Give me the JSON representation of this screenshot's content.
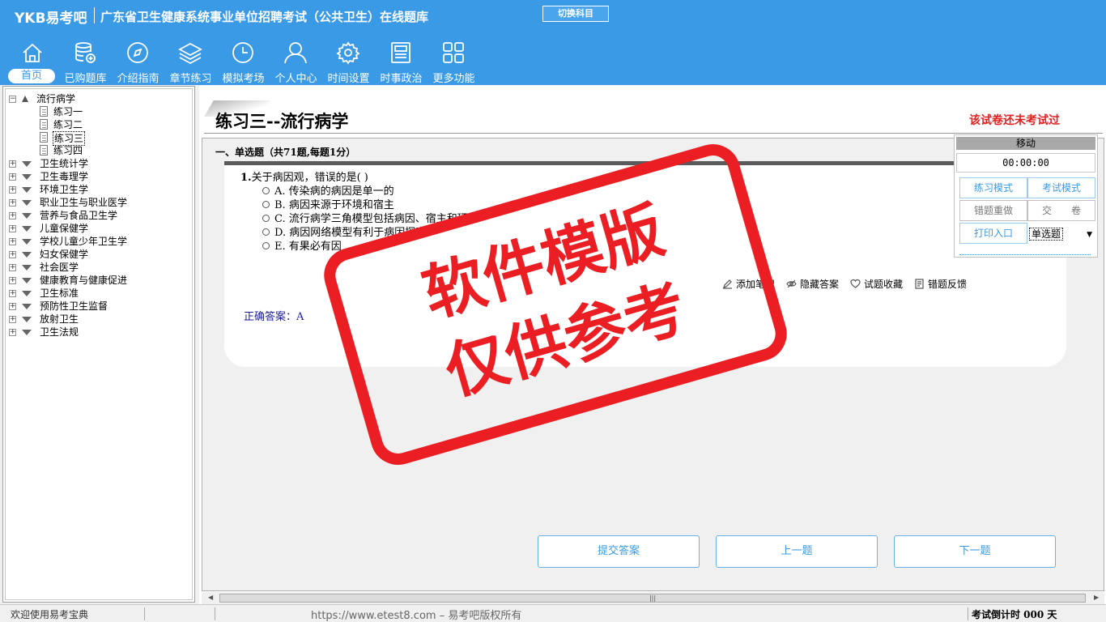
{
  "header": {
    "logo": "YKB易考吧",
    "title": "广东省卫生健康系统事业单位招聘考试（公共卫生）在线题库",
    "switch_subject": "切换科目",
    "nav": [
      {
        "label": "首页",
        "icon": "home-icon"
      },
      {
        "label": "已购题库",
        "icon": "database-icon"
      },
      {
        "label": "介绍指南",
        "icon": "compass-icon"
      },
      {
        "label": "章节练习",
        "icon": "layers-icon"
      },
      {
        "label": "模拟考场",
        "icon": "clock-icon"
      },
      {
        "label": "个人中心",
        "icon": "user-icon"
      },
      {
        "label": "时间设置",
        "icon": "gear-icon"
      },
      {
        "label": "时事政治",
        "icon": "newspaper-icon"
      },
      {
        "label": "更多功能",
        "icon": "grid-icon"
      }
    ]
  },
  "tree": {
    "root": "流行病学",
    "children": [
      "练习一",
      "练习二",
      "练习三",
      "练习四"
    ],
    "selected_child": "练习三",
    "categories": [
      "卫生统计学",
      "卫生毒理学",
      "环境卫生学",
      "职业卫生与职业医学",
      "营养与食品卫生学",
      "儿童保健学",
      "学校儿童少年卫生学",
      "妇女保健学",
      "社会医学",
      "健康教育与健康促进",
      "卫生标准",
      "预防性卫生监督",
      "放射卫生",
      "卫生法规"
    ]
  },
  "exam": {
    "title": "练习三--流行病学",
    "status": "该试卷还未考试过",
    "section": "一、单选题（共71题,每题1分）",
    "question": "关于病因观，错误的是( )",
    "question_number": "1.",
    "options": [
      "A. 传染病的病因是单一的",
      "B. 病因来源于环境和宿主",
      "C. 流行病学三角模型包括病因、宿主和环境",
      "D. 病因网络模型有利于病因探索",
      "E. 有果必有因"
    ],
    "tools": [
      "添加笔记",
      "隐藏答案",
      "试题收藏",
      "错题反馈"
    ],
    "answer": "正确答案：A",
    "buttons": {
      "submit": "提交答案",
      "prev": "上一题",
      "next": "下一题"
    }
  },
  "control": {
    "header": "移动",
    "timer": "00:00:00",
    "practice_mode": "练习模式",
    "exam_mode": "考试模式",
    "redo": "错题重做",
    "hand_in": "交　　卷",
    "print": "打印入口",
    "type_value": "单选题"
  },
  "watermark": {
    "line1": "软件模版",
    "line2": "仅供参考"
  },
  "status": {
    "welcome": "欢迎使用易考宝典",
    "copyright": "https://www.etest8.com – 易考吧版权所有",
    "countdown": "考试倒计时 000 天"
  },
  "colors": {
    "header_bg": "#3a9ae6",
    "status_red": "#e02020",
    "stamp_red": "#ea1e23"
  }
}
